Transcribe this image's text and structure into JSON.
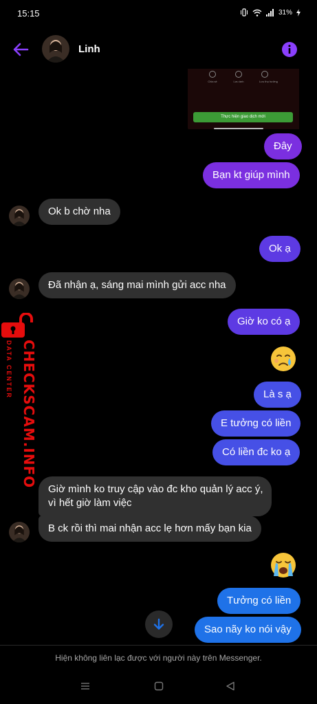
{
  "status_bar": {
    "time": "15:15",
    "battery": "31%"
  },
  "header": {
    "contact_name": "Linh"
  },
  "image_preview": {
    "icon_labels": [
      "Chia sẻ",
      "Lưu ảnh",
      "Lưu thụ hưởng"
    ],
    "button_label": "Thực hiện giao dịch mới"
  },
  "messages": [
    {
      "text": "Đây",
      "side": "outgoing"
    },
    {
      "text": "Bạn kt giúp mình",
      "side": "outgoing"
    },
    {
      "text": "Ok b chờ nha",
      "side": "incoming"
    },
    {
      "text": "Ok ạ",
      "side": "outgoing"
    },
    {
      "text": "Đã nhận ạ, sáng mai mình gửi acc nha",
      "side": "incoming"
    },
    {
      "text": "Giờ ko có ạ",
      "side": "outgoing"
    },
    {
      "text": "Là s ạ",
      "side": "outgoing"
    },
    {
      "text": "E tưởng có liền",
      "side": "outgoing"
    },
    {
      "text": "Có liền đc ko ạ",
      "side": "outgoing"
    },
    {
      "text": "Giờ mình ko truy cập vào đc kho quản lý acc ý,",
      "side": "incoming"
    },
    {
      "text": "vì hết giờ làm việc",
      "side": "incoming"
    },
    {
      "text": "B ck rồi thì mai nhận acc lẹ hơn mấy bạn kia",
      "side": "incoming"
    },
    {
      "text": "Tưởng có liền",
      "side": "outgoing"
    },
    {
      "text": "Sao nãy ko nói vậy",
      "side": "outgoing"
    }
  ],
  "emojis": [
    "crying-face-icon",
    "loudly-crying-face-icon"
  ],
  "watermark": {
    "brand": "CHECKSCAM.INFO",
    "tagline": "DATA CENTER"
  },
  "footer": {
    "notice": "Hiện không liên lạc được với người này trên Messenger."
  },
  "colors": {
    "accent": "#8a3ffc",
    "incoming_bubble": "#303030",
    "outgoing_top": "#7b2fe0",
    "outgoing_bottom": "#1f72e8",
    "watermark_red": "#e60d0d"
  }
}
